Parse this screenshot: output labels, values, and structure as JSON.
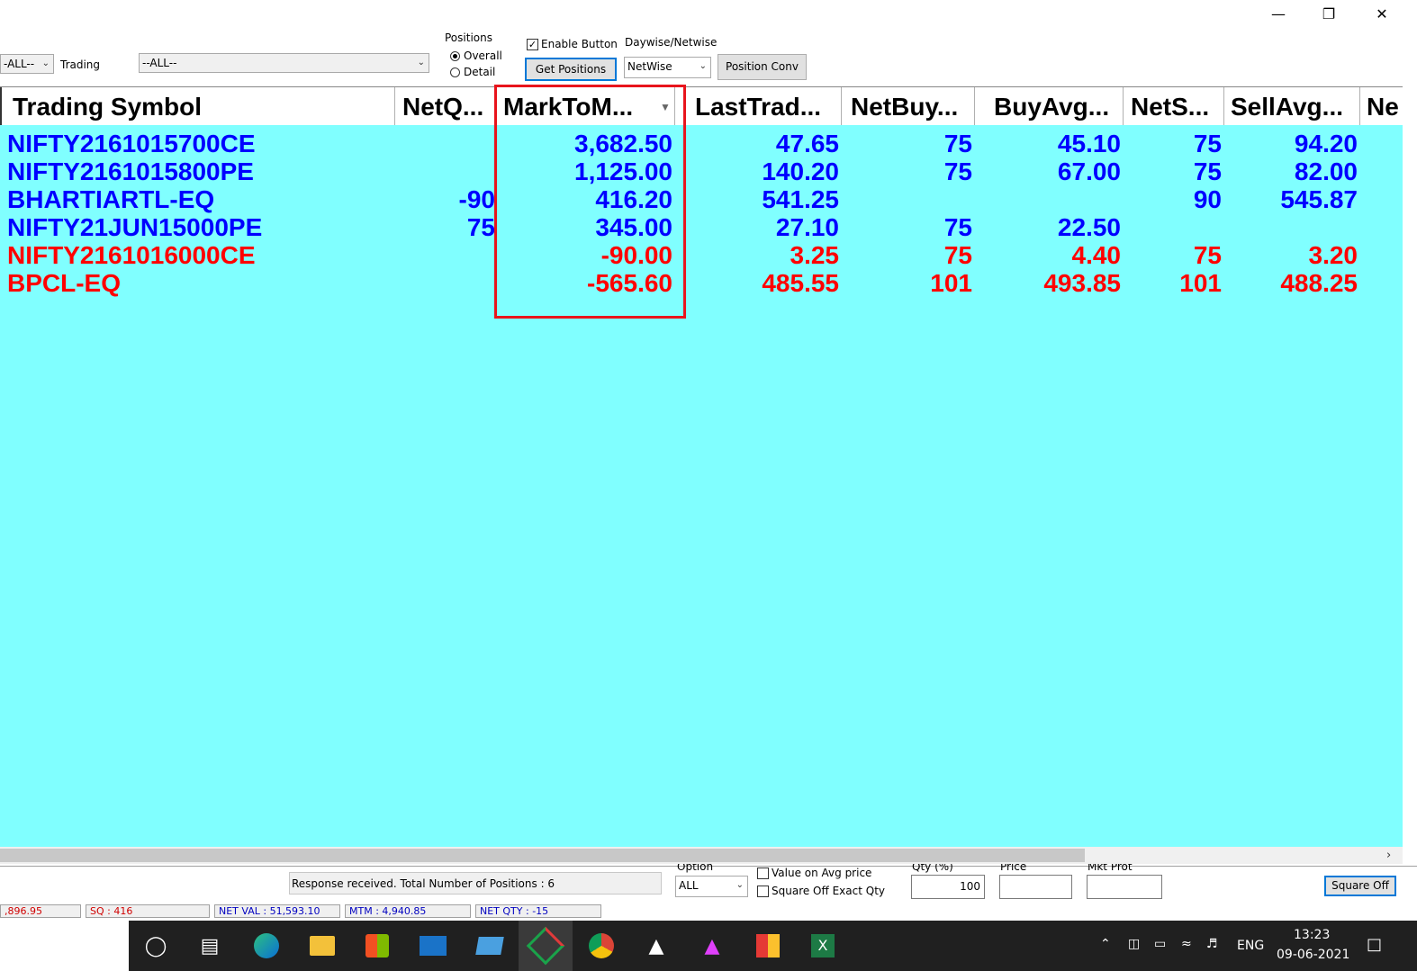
{
  "window": {
    "minimize": "—",
    "restore": "❐",
    "close": "✕"
  },
  "toolbar": {
    "exchange_value": "-ALL--",
    "trading_label": "Trading",
    "trading_value": "--ALL--",
    "positions_label": "Positions",
    "radio_overall": "Overall",
    "radio_detail": "Detail",
    "enable_button_label": "Enable Button",
    "get_positions_label": "Get Positions",
    "daywise_label": "Daywise/Netwise",
    "daywise_value": "NetWise",
    "position_conv_label": "Position Conv"
  },
  "grid": {
    "columns": [
      "Trading Symbol",
      "NetQ...",
      "MarkToM...",
      "LastTrad...",
      "NetBuy...",
      "BuyAvg...",
      "NetS...",
      "SellAvg...",
      "Ne"
    ],
    "rows": [
      {
        "color": "blue",
        "cells": [
          "NIFTY2161015700CE",
          "",
          "3,682.50",
          "47.65",
          "75",
          "45.10",
          "75",
          "94.20"
        ]
      },
      {
        "color": "blue",
        "cells": [
          "NIFTY2161015800PE",
          "",
          "1,125.00",
          "140.20",
          "75",
          "67.00",
          "75",
          "82.00"
        ]
      },
      {
        "color": "blue",
        "cells": [
          "BHARTIARTL-EQ",
          "-90",
          "416.20",
          "541.25",
          "",
          "",
          "90",
          "545.87"
        ]
      },
      {
        "color": "blue",
        "cells": [
          "NIFTY21JUN15000PE",
          "75",
          "345.00",
          "27.10",
          "75",
          "22.50",
          "",
          ""
        ]
      },
      {
        "color": "red",
        "cells": [
          "NIFTY2161016000CE",
          "",
          "-90.00",
          "3.25",
          "75",
          "4.40",
          "75",
          "3.20"
        ]
      },
      {
        "color": "red",
        "cells": [
          "BPCL-EQ",
          "",
          "-565.60",
          "485.55",
          "101",
          "493.85",
          "101",
          "488.25"
        ]
      }
    ]
  },
  "bottom": {
    "status_text": "Response received. Total Number of Positions : 6",
    "option_label": "Option",
    "option_value": "ALL",
    "value_on_avg_label": "Value on Avg  price",
    "square_off_exact_label": "Square Off Exact Qty",
    "qty_label": "Qty (%)",
    "qty_value": "100",
    "price_label": "Price",
    "mkt_prot_label": "Mkt Prot",
    "square_off_button": "Square Off"
  },
  "statusbar": {
    "first": ",896.95",
    "sq": "SQ : 416",
    "net_val": "NET VAL : 51,593.10",
    "mtm": "MTM : 4,940.85",
    "net_qty": "NET QTY : -15"
  },
  "taskbar": {
    "icons": [
      "search-circle-icon",
      "task-view-icon",
      "edge-icon",
      "file-explorer-icon",
      "store-icon",
      "mail-icon",
      "laptop-icon",
      "trading-app-icon",
      "chrome-icon",
      "arrow-app-icon",
      "triangle-app-icon",
      "color-app-icon",
      "excel-icon"
    ],
    "lang": "ENG",
    "time": "13:23",
    "date": "09-06-2021"
  }
}
